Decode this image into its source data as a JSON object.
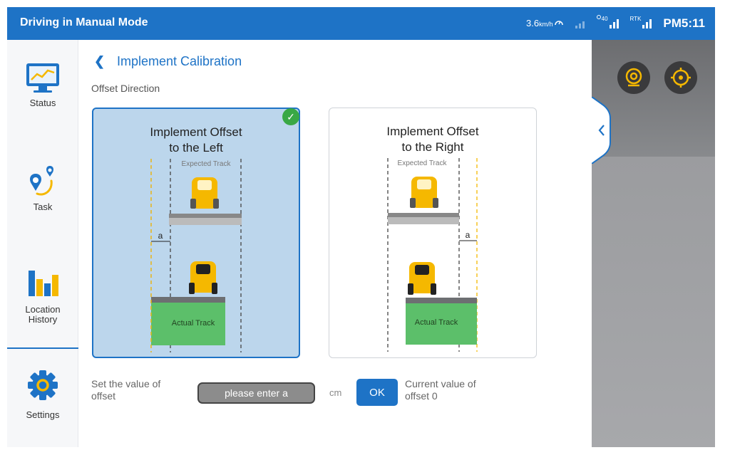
{
  "header": {
    "title": "Driving in Manual Mode",
    "speed_value": "3.6",
    "speed_unit": "km/h",
    "satellite_count": "40",
    "rtk_label": "RTK",
    "clock": "PM5:11"
  },
  "sidebar": {
    "items": [
      {
        "label": "Status",
        "icon": "monitor-chart-icon"
      },
      {
        "label": "Task",
        "icon": "route-pin-icon"
      },
      {
        "label": "Location\nHistory",
        "icon": "bar-chart-icon"
      },
      {
        "label": "Settings",
        "icon": "gear-icon"
      }
    ]
  },
  "main": {
    "title": "Implement Calibration",
    "section_label": "Offset Direction",
    "cards": [
      {
        "title_line1": "Implement Offset",
        "title_line2": "to the Left",
        "expected": "Expected Track",
        "actual": "Actual Track",
        "offset_symbol": "a",
        "selected": true
      },
      {
        "title_line1": "Implement Offset",
        "title_line2": "to the Right",
        "expected": "Expected Track",
        "actual": "Actual Track",
        "offset_symbol": "a",
        "selected": false
      }
    ],
    "offset_label": "Set the value of offset",
    "offset_placeholder": "please enter a",
    "unit": "cm",
    "ok_label": "OK",
    "current_label": "Current value of",
    "current_value": "offset 0"
  },
  "colors": {
    "primary": "#1e73c6",
    "selected_card": "#bcd6ec",
    "check": "#39a845",
    "track_green": "#5cbf6a",
    "tractor_yellow": "#f5b800"
  }
}
